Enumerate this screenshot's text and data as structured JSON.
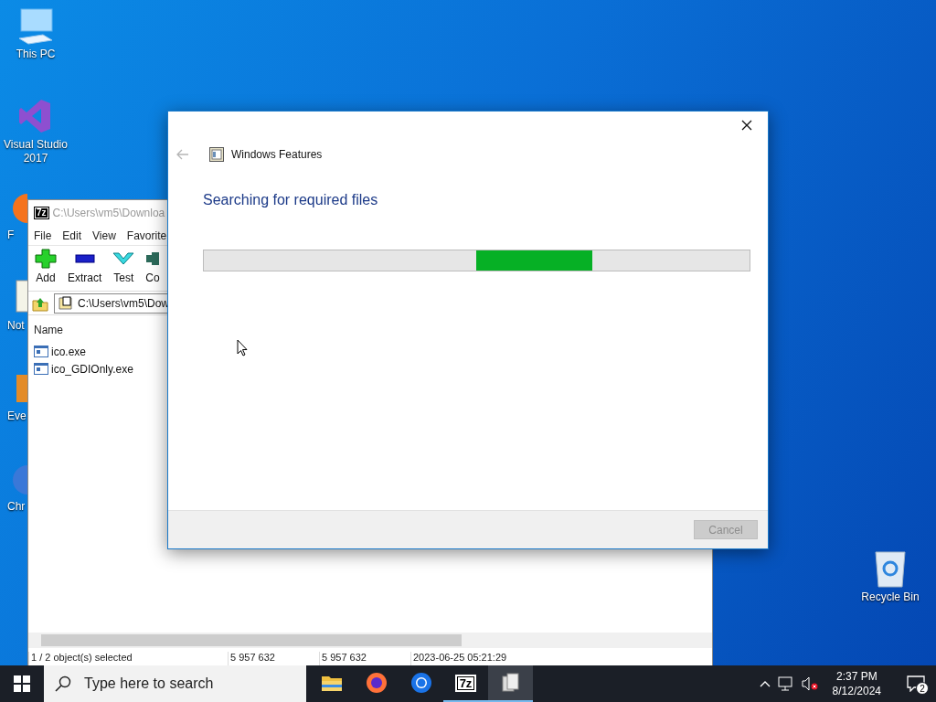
{
  "desktop_icons": [
    {
      "kind": "pc",
      "label": "This PC"
    },
    {
      "kind": "vs",
      "label": "Visual Studio 2017"
    },
    {
      "kind": "firefox",
      "label": "F"
    },
    {
      "kind": "notepad",
      "label": "Not"
    },
    {
      "kind": "event",
      "label": "Eve"
    },
    {
      "kind": "chrome",
      "label": "Chr"
    }
  ],
  "recycle_bin": {
    "label": "Recycle Bin"
  },
  "archiver_window": {
    "logo": "7z",
    "title": "C:\\Users\\vm5\\Downloa",
    "menu": [
      "File",
      "Edit",
      "View",
      "Favorite"
    ],
    "toolbar": [
      {
        "kind": "add",
        "label": "Add"
      },
      {
        "kind": "extract",
        "label": "Extract"
      },
      {
        "kind": "test",
        "label": "Test"
      },
      {
        "kind": "copy",
        "label": "Co"
      }
    ],
    "address": "C:\\Users\\vm5\\Dow",
    "columns": [
      "Name"
    ],
    "files": [
      {
        "name": "ico.exe",
        "selected": false
      },
      {
        "name": "ico_GDIOnly.exe",
        "selected": false
      }
    ],
    "status_bar": [
      "1 / 2 object(s) selected",
      "5 957 632",
      "5 957 632",
      "2023-06-25 05:21:29"
    ]
  },
  "dialog": {
    "title": "Windows Features",
    "heading": "Searching for required files",
    "progress": {
      "kind": "marquee"
    },
    "cancel": {
      "label": "Cancel",
      "disabled": true
    }
  },
  "taskbar": {
    "search": {
      "placeholder": "Type here to search"
    },
    "apps": [
      {
        "kind": "folder",
        "open": false,
        "selected": false
      },
      {
        "kind": "firefox",
        "open": false,
        "selected": false
      },
      {
        "kind": "chrome",
        "open": false,
        "selected": false
      },
      {
        "kind": "archiver",
        "label": "7z",
        "open": true,
        "selected": false
      },
      {
        "kind": "features",
        "open": true,
        "selected": true
      }
    ],
    "time": "2:37 PM",
    "date": "8/12/2024",
    "notifications": "2"
  }
}
